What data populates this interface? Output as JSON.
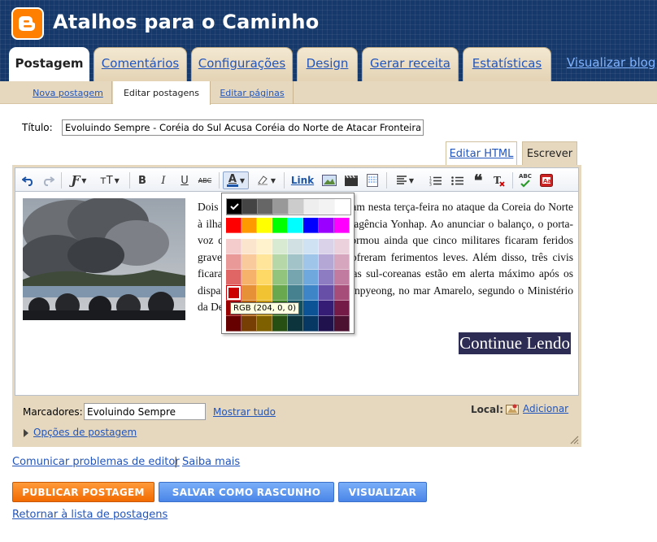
{
  "header": {
    "blog_title": "Atalhos para o Caminho",
    "view_blog": "Visualizar blog",
    "tabs": [
      {
        "label": "Postagem",
        "active": true
      },
      {
        "label": "Comentários",
        "active": false
      },
      {
        "label": "Configurações",
        "active": false
      },
      {
        "label": "Design",
        "active": false
      },
      {
        "label": "Gerar receita",
        "active": false
      },
      {
        "label": "Estatísticas",
        "active": false
      }
    ]
  },
  "subnav": {
    "items": [
      {
        "label": "Nova postagem",
        "active": false
      },
      {
        "label": "Editar postagens",
        "active": true
      },
      {
        "label": "Editar páginas",
        "active": false
      }
    ]
  },
  "post": {
    "title_label": "Título:",
    "title_value": "Evoluindo Sempre - Coréia do Sul Acusa Coréia do Norte de Atacar Fronteira",
    "body_text": "Dois militares sul-coreanos morreram nesta terça-feira no ataque da Coreia do Norte à ilha de Yeonpyeong, informou a agência Yonhap. Ao anunciar o balanço, o porta-voz do exército Lee Hong-Ki informou ainda que cinco militares ficaram feridos gravemente feridos e outros 10 sofreram ferimentos leves. Além disso, três civis ficaram feridos. As Forças Armadas sul-coreanas estão em alerta máximo após os disparos norte-coreanos contra Yeonpyeong, no mar Amarelo, segundo o Ministério da Defesa...",
    "continue_label": "Continue Lendo"
  },
  "modes": {
    "html_label": "Editar HTML",
    "compose_label": "Escrever"
  },
  "toolbar": {
    "font_label": "Ƒ",
    "size_label": "тT",
    "bold": "B",
    "italic": "I",
    "underline": "U",
    "strike": "ABC",
    "text_color": "A",
    "link_label": "Link",
    "spellcheck": "ABC"
  },
  "color_picker": {
    "tooltip": "RGB (204, 0, 0)",
    "gray_row": [
      "#000000",
      "#444444",
      "#666666",
      "#999999",
      "#cccccc",
      "#eeeeee",
      "#f3f3f3",
      "#ffffff"
    ],
    "bright_row": [
      "#ff0000",
      "#ff9900",
      "#ffff00",
      "#00ff00",
      "#00ffff",
      "#0000ff",
      "#9900ff",
      "#ff00ff"
    ],
    "tones": [
      [
        "#f4cccc",
        "#fce5cd",
        "#fff2cc",
        "#d9ead3",
        "#d0e0e3",
        "#cfe2f3",
        "#d9d2e9",
        "#ead1dc"
      ],
      [
        "#ea9999",
        "#f9cb9c",
        "#ffe599",
        "#b6d7a8",
        "#a2c4c9",
        "#9fc5e8",
        "#b4a7d6",
        "#d5a6bd"
      ],
      [
        "#e06666",
        "#f6b26b",
        "#ffd966",
        "#93c47d",
        "#76a5af",
        "#6fa8dc",
        "#8e7cc3",
        "#c27ba0"
      ],
      [
        "#cc0000",
        "#e69138",
        "#f1c232",
        "#6aa84f",
        "#45818e",
        "#3d85c6",
        "#674ea7",
        "#a64d79"
      ],
      [
        "#990000",
        "#b45f06",
        "#bf9000",
        "#38761d",
        "#134f5c",
        "#0b5394",
        "#351c75",
        "#741b47"
      ],
      [
        "#660000",
        "#783f04",
        "#7f6000",
        "#274e13",
        "#0c343d",
        "#073763",
        "#20124d",
        "#4c1130"
      ]
    ],
    "selected_color": "#cc0000"
  },
  "labels_bar": {
    "labels_label": "Marcadores:",
    "labels_value": "Evoluindo Sempre",
    "show_all": "Mostrar tudo",
    "location_label": "Local:",
    "location_add": "Adicionar",
    "post_options": "Opções de postagem"
  },
  "footer": {
    "report_link": "Comunicar problemas de editor",
    "separator": "|",
    "learn_more": "Saiba mais",
    "publish": "PUBLICAR POSTAGEM",
    "save_draft": "SALVAR COMO RASCUNHO",
    "preview": "VISUALIZAR",
    "return_link": "Retornar à lista de postagens"
  },
  "colors": {
    "header_bg": "#16396b",
    "tab_bg": "#f3e8d2",
    "panel_bg": "#e5d8bf",
    "link": "#2255bb",
    "publish_orange": "#f26b00",
    "action_blue": "#4a86e8"
  },
  "icons": {
    "logo": "blogger-logo-icon",
    "undo": "undo-icon",
    "redo": "redo-icon",
    "image": "image-icon",
    "video": "video-icon",
    "jump_break": "jump-break-icon",
    "align": "align-icon",
    "numbered_list": "numbered-list-icon",
    "bullet_list": "bullet-list-icon",
    "quote": "quote-icon",
    "remove_format": "remove-format-icon",
    "spellcheck": "spellcheck-icon",
    "transliterate": "transliterate-icon",
    "location": "location-icon",
    "resize": "resize-grip-icon"
  }
}
